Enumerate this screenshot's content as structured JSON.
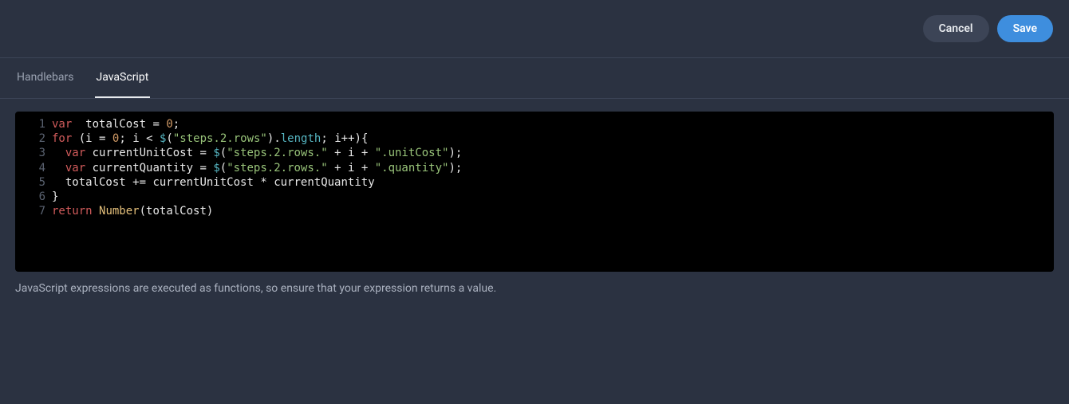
{
  "header": {
    "cancel_label": "Cancel",
    "save_label": "Save"
  },
  "tabs": {
    "handlebars_label": "Handlebars",
    "javascript_label": "JavaScript"
  },
  "help_text": "JavaScript expressions are executed as functions, so ensure that your expression returns a value.",
  "code": {
    "line1": {
      "kw_var": "var",
      "sp1": "  ",
      "ident": "totalCost",
      "sp2": " ",
      "op": "=",
      "sp3": " ",
      "num": "0",
      "semi": ";"
    },
    "line2": {
      "kw_for": "for",
      "sp1": " ",
      "lparen": "(",
      "i1": "i",
      "sp2": " ",
      "eq": "=",
      "sp3": " ",
      "zero": "0",
      "semi1": ";",
      "sp4": " ",
      "i2": "i",
      "sp5": " ",
      "lt": "<",
      "sp6": " ",
      "dollar": "$",
      "lp2": "(",
      "str": "\"steps.2.rows\"",
      "rp2": ")",
      "dot": ".",
      "length": "length",
      "semi2": ";",
      "sp7": " ",
      "i3": "i",
      "inc": "++",
      "rparen": ")",
      "brace": "{"
    },
    "line3": {
      "indent": "  ",
      "kw_var": "var",
      "sp1": " ",
      "ident": "currentUnitCost",
      "sp2": " ",
      "eq": "=",
      "sp3": " ",
      "dollar": "$",
      "lp": "(",
      "str1": "\"steps.2.rows.\"",
      "sp4": " ",
      "plus1": "+",
      "sp5": " ",
      "i": "i",
      "sp6": " ",
      "plus2": "+",
      "sp7": " ",
      "str2": "\".unitCost\"",
      "rp": ")",
      "semi": ";"
    },
    "line4": {
      "indent": "  ",
      "kw_var": "var",
      "sp1": " ",
      "ident": "currentQuantity",
      "sp2": " ",
      "eq": "=",
      "sp3": " ",
      "dollar": "$",
      "lp": "(",
      "str1": "\"steps.2.rows.\"",
      "sp4": " ",
      "plus1": "+",
      "sp5": " ",
      "i": "i",
      "sp6": " ",
      "plus2": "+",
      "sp7": " ",
      "str2": "\".quantity\"",
      "rp": ")",
      "semi": ";"
    },
    "line5": {
      "indent": "  ",
      "ident1": "totalCost",
      "sp1": " ",
      "op": "+=",
      "sp2": " ",
      "ident2": "currentUnitCost",
      "sp3": " ",
      "mul": "*",
      "sp4": " ",
      "ident3": "currentQuantity"
    },
    "line6": {
      "brace": "}"
    },
    "line7": {
      "kw_return": "return",
      "sp1": " ",
      "cls": "Number",
      "lp": "(",
      "ident": "totalCost",
      "rp": ")"
    }
  }
}
